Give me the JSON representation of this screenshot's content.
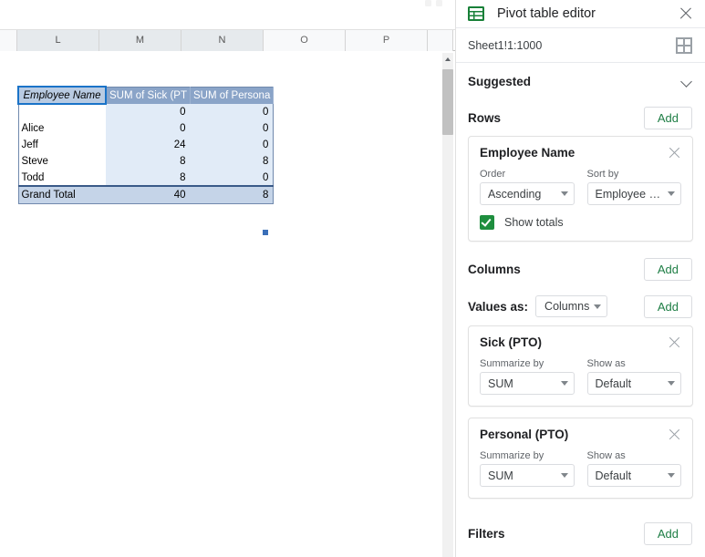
{
  "sheet": {
    "column_headers": [
      {
        "label": "L",
        "selected": true
      },
      {
        "label": "M",
        "selected": true
      },
      {
        "label": "N",
        "selected": true
      },
      {
        "label": "O",
        "selected": false
      },
      {
        "label": "P",
        "selected": false
      }
    ],
    "pivot_table": {
      "headers": [
        "Employee Name",
        "SUM of Sick (PT",
        "SUM of Persona"
      ],
      "rows": [
        {
          "label": "",
          "values": [
            "0",
            "0"
          ]
        },
        {
          "label": "Alice",
          "values": [
            "0",
            "0"
          ]
        },
        {
          "label": "Jeff",
          "values": [
            "24",
            "0"
          ]
        },
        {
          "label": "Steve",
          "values": [
            "8",
            "8"
          ]
        },
        {
          "label": "Todd",
          "values": [
            "8",
            "0"
          ]
        }
      ],
      "total_row": {
        "label": "Grand Total",
        "values": [
          "40",
          "8"
        ]
      }
    }
  },
  "editor": {
    "title": "Pivot table editor",
    "icon": "pivot-table-icon",
    "close_icon": "close-icon",
    "range": {
      "value": "Sheet1!1:1000",
      "select_range_icon": "grid-range-icon"
    },
    "suggested": {
      "label": "Suggested",
      "expand_icon": "chevron-down-icon"
    },
    "rows_section": {
      "label": "Rows",
      "add_label": "Add",
      "fields": [
        {
          "title": "Employee Name",
          "remove_icon": "close-icon",
          "order_label": "Order",
          "order_value": "Ascending",
          "sort_by_label": "Sort by",
          "sort_by_value": "Employee Na...",
          "show_totals_label": "Show totals",
          "show_totals_checked": true
        }
      ]
    },
    "columns_section": {
      "label": "Columns",
      "add_label": "Add"
    },
    "values_section": {
      "values_as_label": "Values as:",
      "values_as_value": "Columns",
      "add_label": "Add",
      "fields": [
        {
          "title": "Sick (PTO)",
          "remove_icon": "close-icon",
          "summarize_label": "Summarize by",
          "summarize_value": "SUM",
          "show_as_label": "Show as",
          "show_as_value": "Default"
        },
        {
          "title": "Personal (PTO)",
          "remove_icon": "close-icon",
          "summarize_label": "Summarize by",
          "summarize_value": "SUM",
          "show_as_label": "Show as",
          "show_as_value": "Default"
        }
      ]
    },
    "filters_section": {
      "label": "Filters",
      "add_label": "Add"
    }
  },
  "colors": {
    "accent_green": "#1e8e3e",
    "pivot_header_blue": "#8aa4c8",
    "pivot_body_blue": "#e1ebf7",
    "pivot_total_blue": "#c5d4e8",
    "selection_border": "#1a73c8"
  }
}
